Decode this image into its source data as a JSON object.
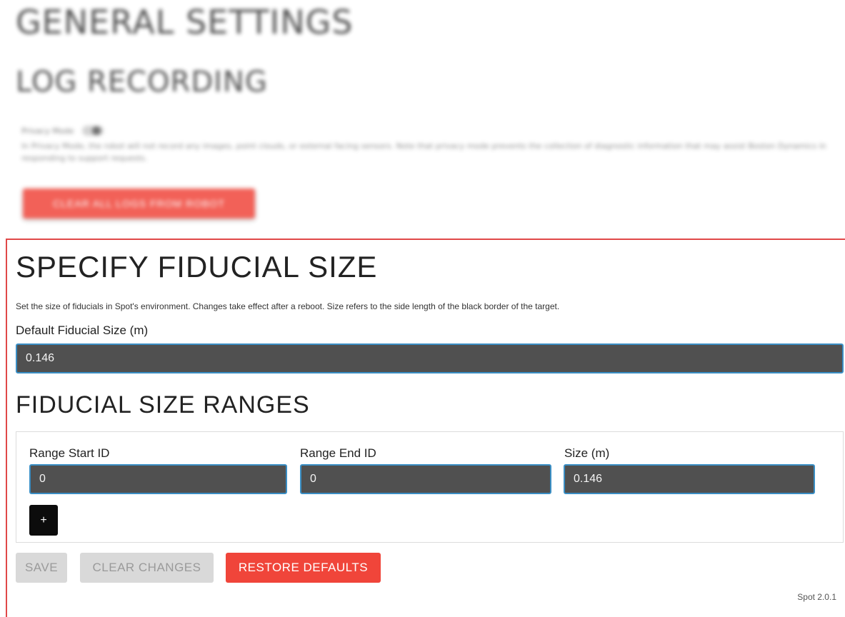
{
  "general": {
    "title": "GENERAL SETTINGS"
  },
  "log_recording": {
    "title": "LOG RECORDING",
    "privacy_label": "Privacy Mode",
    "privacy_description": "In Privacy Mode, the robot will not record any images, point clouds, or external facing sensors. Note that privacy mode prevents the collection of diagnostic information that may assist Boston Dynamics in responding to support requests.",
    "clear_logs_label": "CLEAR ALL LOGS FROM ROBOT"
  },
  "fiducial": {
    "title": "SPECIFY FIDUCIAL SIZE",
    "description": "Set the size of fiducials in Spot's environment. Changes take effect after a reboot. Size refers to the side length of the black border of the target.",
    "default_label": "Default Fiducial Size (m)",
    "default_value": "0.146"
  },
  "ranges": {
    "title": "FIDUCIAL SIZE RANGES",
    "columns": [
      "Range Start ID",
      "Range End ID",
      "Size (m)"
    ],
    "rows": [
      {
        "start": "0",
        "end": "0",
        "size": "0.146"
      }
    ],
    "add_label": "+"
  },
  "actions": {
    "save_label": "SAVE",
    "clear_label": "CLEAR CHANGES",
    "restore_label": "RESTORE DEFAULTS"
  },
  "footer": {
    "version": "Spot 2.0.1"
  },
  "colors": {
    "accent_red": "#f0453a",
    "input_bg": "#505050",
    "input_border": "#3a8ec4",
    "highlight_frame": "#e04848"
  }
}
